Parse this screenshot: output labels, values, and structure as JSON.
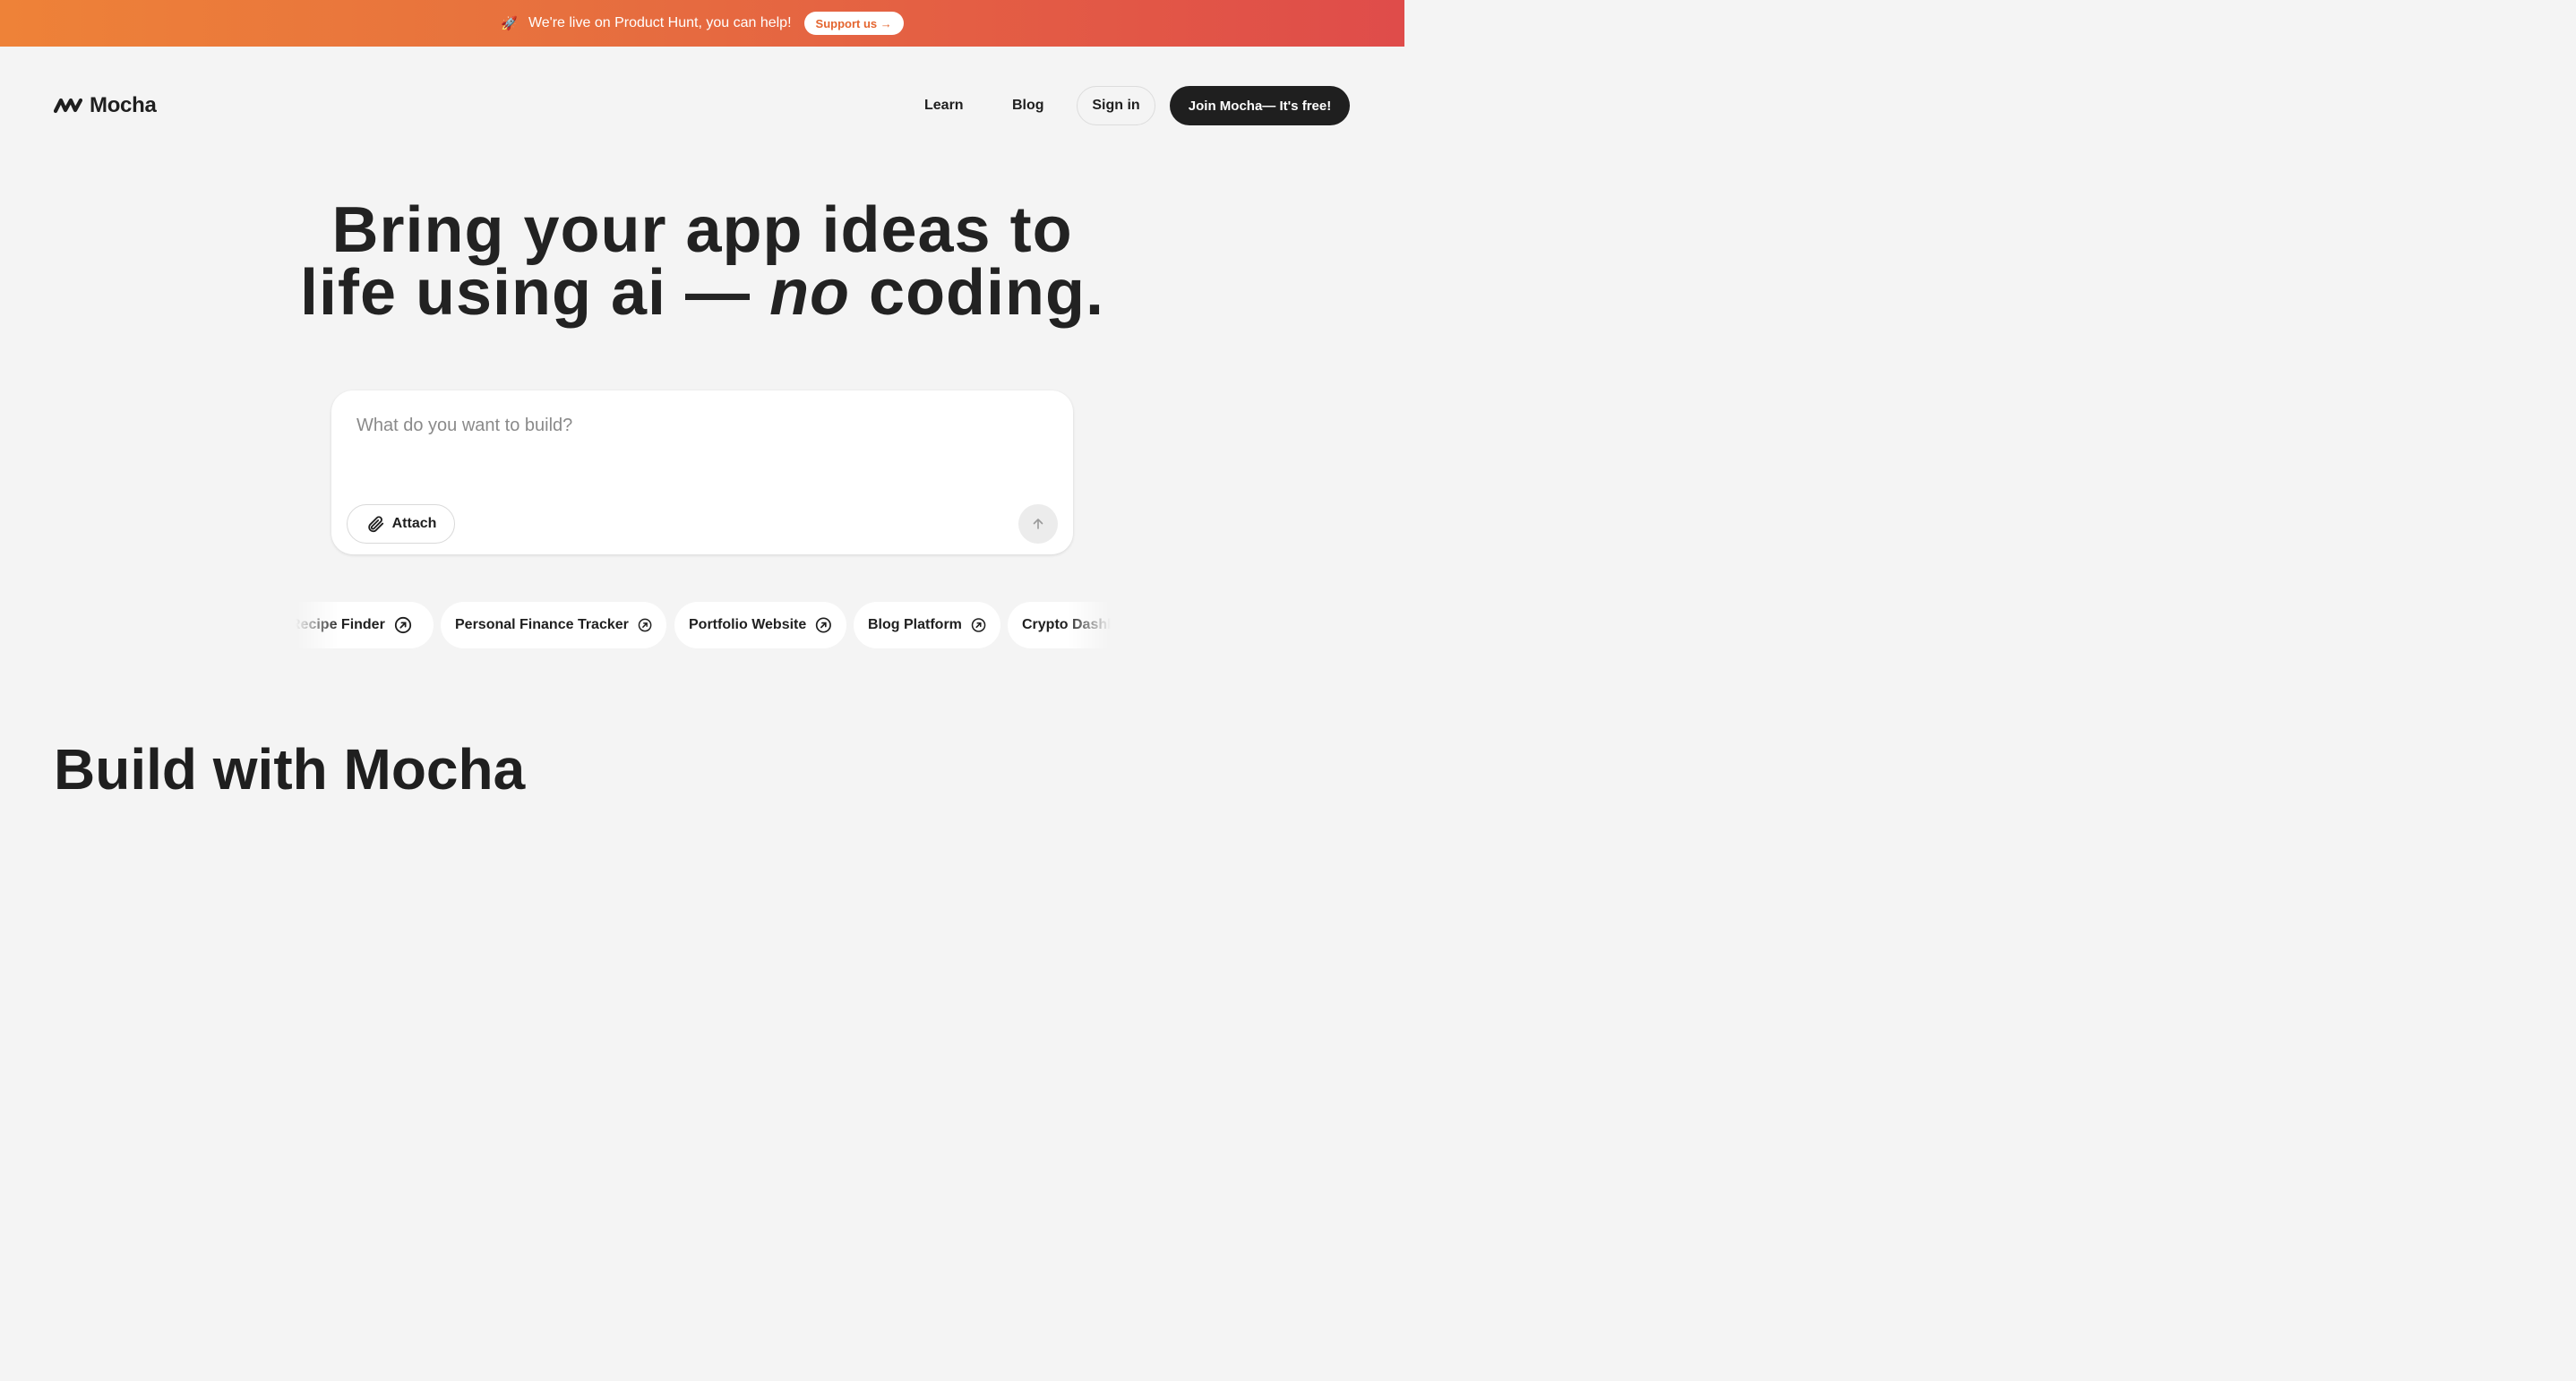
{
  "banner": {
    "icon": "rocket-icon",
    "emoji": "🚀",
    "text": "We're live on Product Hunt, you can help!",
    "cta": "Support us →",
    "cta_color": "#e4652f"
  },
  "header": {
    "logo_text": "Mocha",
    "nav": {
      "learn": "Learn",
      "blog": "Blog",
      "sign_in": "Sign in",
      "join": "Join Mocha— It's free!"
    }
  },
  "hero": {
    "line1": "Bring your app ideas to",
    "line2_before": "life using ai — ",
    "line2_emphasis": "no",
    "line2_after": " coding."
  },
  "prompt": {
    "placeholder": "What do you want to build?",
    "value": "",
    "attach_label": "Attach",
    "attach_icon": "paperclip-icon",
    "send_icon": "arrow-up-icon"
  },
  "suggestions": [
    {
      "label": "Recipe Finder",
      "icon": "arrow-up-right-circle-icon"
    },
    {
      "label": "Personal Finance Tracker",
      "icon": "arrow-up-right-circle-icon"
    },
    {
      "label": "Portfolio Website",
      "icon": "arrow-up-right-circle-icon"
    },
    {
      "label": "Blog Platform",
      "icon": "arrow-up-right-circle-icon"
    },
    {
      "label": "Crypto Dashboard",
      "icon": "arrow-up-right-circle-icon"
    }
  ],
  "section": {
    "title": "Build with Mocha"
  },
  "colors": {
    "background": "#f4f4f4",
    "text": "#1f1f1f",
    "banner_start": "#ee8238",
    "banner_end": "#df4c4a",
    "primary_button": "#1f1f1f"
  }
}
